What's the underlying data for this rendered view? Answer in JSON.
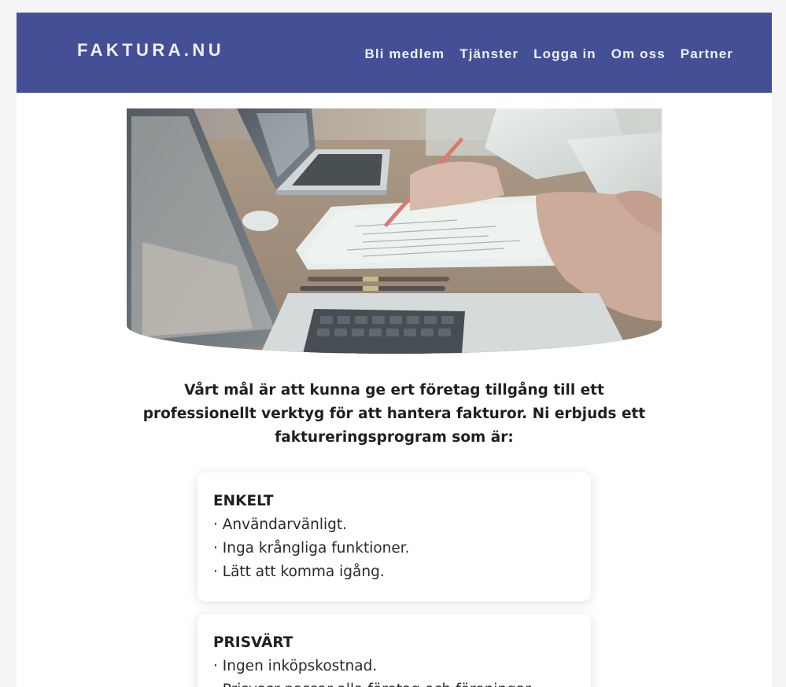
{
  "header": {
    "logo": "FAKTURA.NU",
    "nav": [
      {
        "label": "Bli medlem"
      },
      {
        "label": "Tjänster"
      },
      {
        "label": "Logga in"
      },
      {
        "label": "Om oss"
      },
      {
        "label": "Partner"
      }
    ]
  },
  "hero": {
    "image": "office-desk-laptops-paperwork-photo"
  },
  "intro": {
    "text": "Vårt mål är att kunna ge ert företag tillgång till ett professionellt verktyg för att hantera fakturor. Ni erbjuds ett faktureringsprogram som är:"
  },
  "features": [
    {
      "title": "ENKELT",
      "items": [
        "· Användarvänligt.",
        "· Inga krångliga funktioner.",
        "· Lätt att komma igång."
      ]
    },
    {
      "title": "PRISVÄRT",
      "items": [
        "· Ingen inköpskostnad.",
        "· Prisvasr passar alla företag och föreningar."
      ]
    }
  ],
  "colors": {
    "header_bg": "#444f96",
    "header_text": "#eef0fb",
    "page_bg": "#f5f5f5",
    "card_bg": "#ffffff"
  }
}
